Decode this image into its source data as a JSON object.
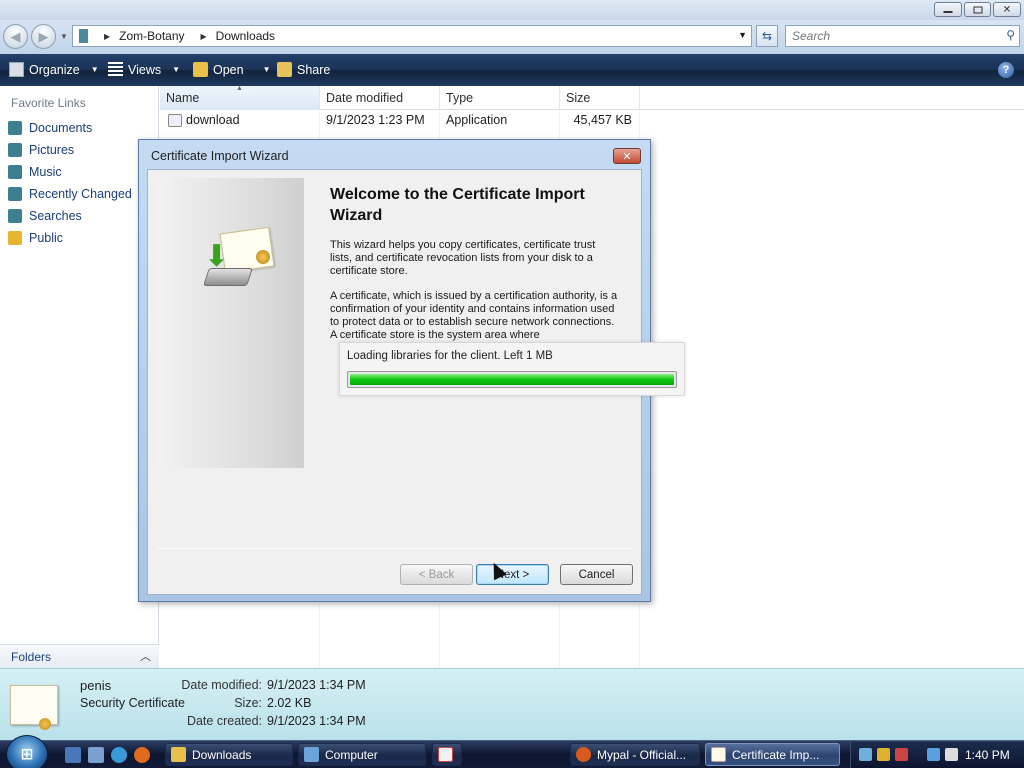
{
  "address": {
    "back_icon": "back-arrow-icon",
    "forward_icon": "forward-arrow-icon",
    "path": [
      "Zom-Botany",
      "Downloads"
    ],
    "search_placeholder": "Search"
  },
  "toolbar": {
    "organize": "Organize",
    "views": "Views",
    "open": "Open",
    "share": "Share"
  },
  "favorites": {
    "header": "Favorite Links",
    "items": [
      {
        "label": "Documents",
        "icon": "documents-icon",
        "color": "#3d7e8f"
      },
      {
        "label": "Pictures",
        "icon": "pictures-icon",
        "color": "#3d7e8f"
      },
      {
        "label": "Music",
        "icon": "music-icon",
        "color": "#3d7e8f"
      },
      {
        "label": "Recently Changed",
        "icon": "recent-icon",
        "color": "#3d7e8f"
      },
      {
        "label": "Searches",
        "icon": "searches-icon",
        "color": "#3d7e8f"
      },
      {
        "label": "Public",
        "icon": "public-folder-icon",
        "color": "#e8b530"
      }
    ],
    "folders_label": "Folders"
  },
  "filelist": {
    "columns": [
      "Name",
      "Date modified",
      "Type",
      "Size"
    ],
    "rows": [
      {
        "name": "download",
        "modified": "9/1/2023 1:23 PM",
        "type": "Application",
        "size": "45,457 KB"
      }
    ]
  },
  "details": {
    "name": "penis",
    "type": "Security Certificate",
    "modified_label": "Date modified:",
    "modified_value": "9/1/2023 1:34 PM",
    "size_label": "Size:",
    "size_value": "2.02 KB",
    "created_label": "Date created:",
    "created_value": "9/1/2023 1:34 PM"
  },
  "wizard": {
    "title": "Certificate Import Wizard",
    "heading": "Welcome to the Certificate Import Wizard",
    "para1": "This wizard helps you copy certificates, certificate trust lists, and certificate revocation lists from your disk to a certificate store.",
    "para2": "A certificate, which is issued by a certification authority, is a confirmation of your identity and contains information used to protect data or to establish secure network connections. A certificate store is the system area where",
    "back": "< Back",
    "next": "Next >",
    "cancel": "Cancel"
  },
  "loader": {
    "text": "Loading libraries for the client. Left 1 MB",
    "progress_percent": 100
  },
  "taskbar": {
    "tasks": [
      {
        "label": "Downloads",
        "icon": "folder-icon"
      },
      {
        "label": "Computer",
        "icon": "computer-icon"
      },
      {
        "label": "",
        "icon": "java-icon"
      },
      {
        "label": "Mypal - Official...",
        "icon": "mypal-icon"
      },
      {
        "label": "Certificate Imp...",
        "icon": "certificate-icon"
      }
    ],
    "clock": "1:40 PM"
  }
}
